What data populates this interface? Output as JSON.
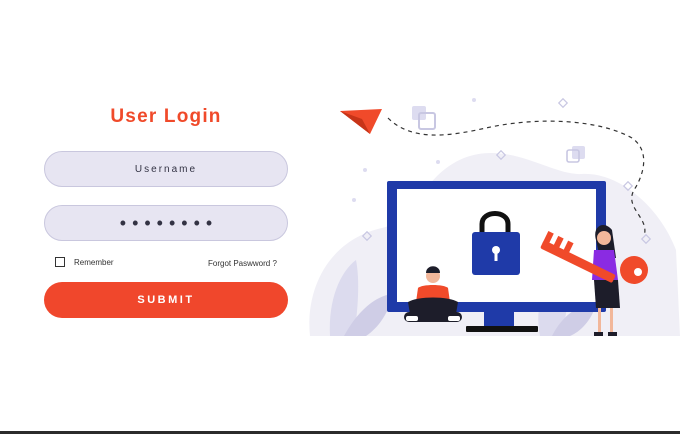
{
  "login": {
    "title": "User Login",
    "username_placeholder": "Username",
    "password_mask": "••••••••",
    "remember_label": "Remember",
    "forgot_label": "Forgot Paswword ?",
    "submit_label": "SUBMIT"
  },
  "colors": {
    "accent": "#f04a2a",
    "field_bg": "#e7e5f2",
    "monitor_blue": "#1f3aa8",
    "person_purple": "#8a2be2"
  },
  "icons": {
    "checkbox": "checkbox-icon",
    "lock": "padlock-icon",
    "key": "key-icon",
    "plane": "paper-plane-icon"
  }
}
